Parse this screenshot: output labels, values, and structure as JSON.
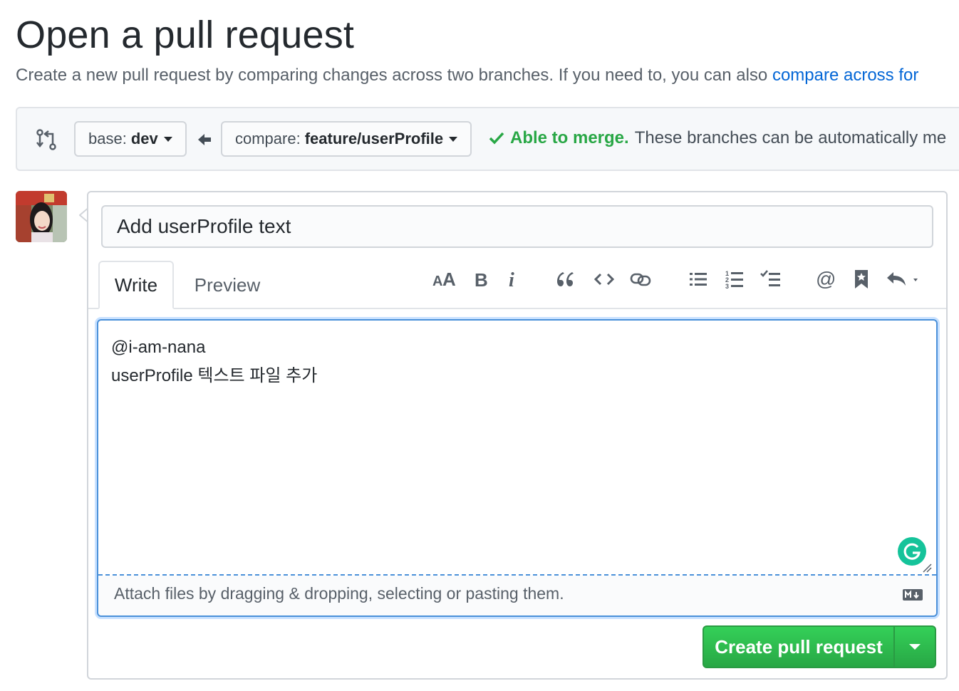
{
  "page": {
    "title": "Open a pull request",
    "subtitle": "Create a new pull request by comparing changes across two branches. If you need to, you can also ",
    "subtitle_link": "compare across for"
  },
  "range": {
    "base_label": "base:",
    "base_value": "dev",
    "compare_label": "compare:",
    "compare_value": "feature/userProfile",
    "merge_status": "Able to merge.",
    "merge_message": "These branches can be automatically me"
  },
  "form": {
    "title_value": "Add userProfile text",
    "tabs": [
      {
        "label": "Write",
        "active": true
      },
      {
        "label": "Preview",
        "active": false
      }
    ],
    "toolbar_icons": [
      "text-size-icon",
      "bold-icon",
      "italic-icon",
      "quote-icon",
      "code-icon",
      "link-icon",
      "unordered-list-icon",
      "ordered-list-icon",
      "task-list-icon",
      "mention-icon",
      "saved-reply-icon",
      "reply-icon"
    ],
    "body_text": "@i-am-nana\nuserProfile 텍스트 파일 추가",
    "attach_hint": "Attach files by dragging & dropping, selecting or pasting them.",
    "submit_label": "Create pull request"
  },
  "colors": {
    "accent_link": "#0366d6",
    "success": "#28a745",
    "focus_border": "#4a90d9",
    "grammarly": "#15c39a"
  }
}
